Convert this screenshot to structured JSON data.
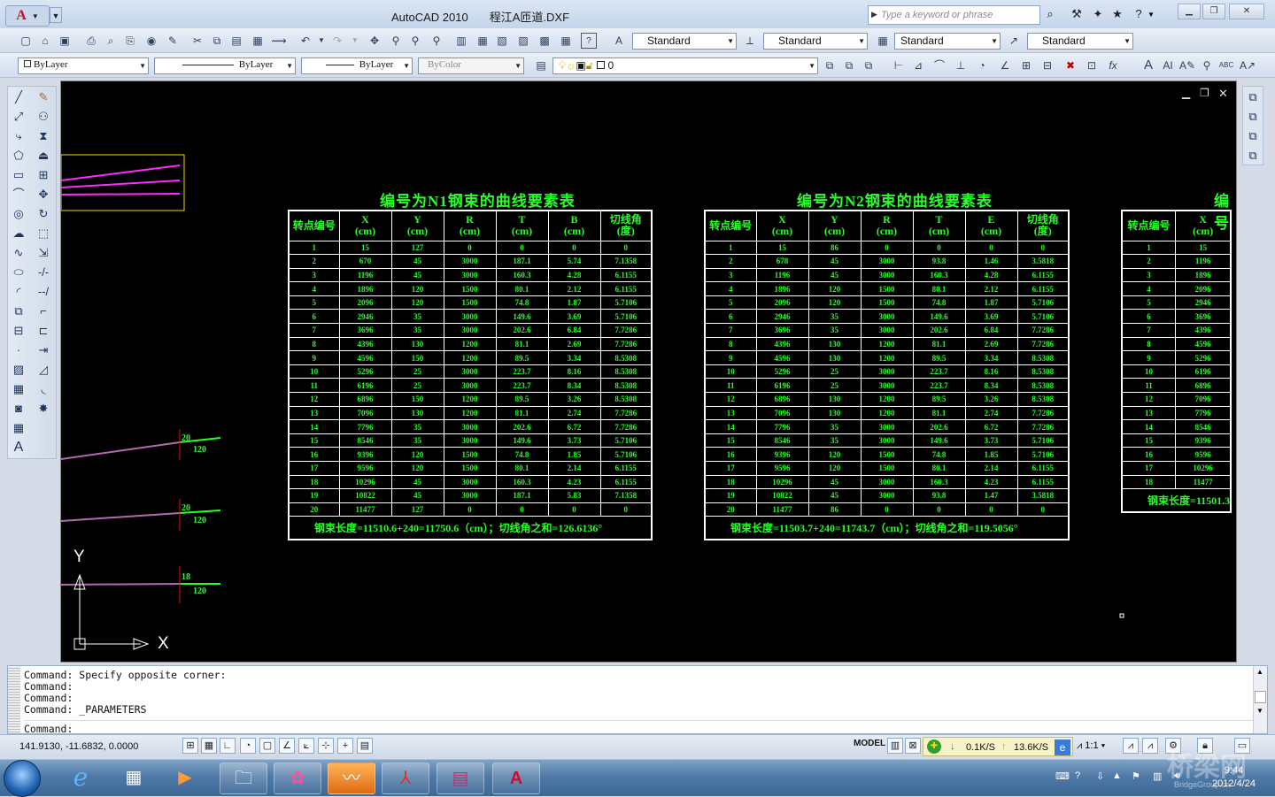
{
  "app": {
    "title": "AutoCAD 2010",
    "file_name": "程江A匝道.DXF"
  },
  "help": {
    "search_placeholder": "Type a keyword or phrase"
  },
  "icons": {
    "app_menu": "autocad-logo-icon",
    "window": [
      "minimize-icon",
      "restore-icon",
      "close-icon"
    ],
    "help_tools": [
      "binoculars-icon",
      "wrench-icon",
      "communication-icon",
      "favorites-icon",
      "help-icon"
    ]
  },
  "styles_toolbar": {
    "text_style": "Standard",
    "dim_style": "Standard",
    "table_style": "Standard",
    "mleader_style": "Standard"
  },
  "properties_toolbar": {
    "layer": "ByLayer",
    "linetype": "ByLayer",
    "lineweight": "ByLayer",
    "plotstyle": "ByColor",
    "current_layer": "0"
  },
  "drawing": {
    "tables": [
      {
        "title": "编号为N1钢束的曲线要素表",
        "headers": [
          [
            "转点编号",
            ""
          ],
          [
            "X",
            "(cm)"
          ],
          [
            "Y",
            "(cm)"
          ],
          [
            "R",
            "(cm)"
          ],
          [
            "T",
            "(cm)"
          ],
          [
            "B",
            "(cm)"
          ],
          [
            "切线角",
            "(度)"
          ]
        ],
        "rows": [
          [
            "1",
            "15",
            "127",
            "0",
            "0",
            "0",
            "0"
          ],
          [
            "2",
            "670",
            "45",
            "3000",
            "187.1",
            "5.74",
            "7.1358"
          ],
          [
            "3",
            "1196",
            "45",
            "3000",
            "160.3",
            "4.28",
            "6.1155"
          ],
          [
            "4",
            "1896",
            "120",
            "1500",
            "80.1",
            "2.12",
            "6.1155"
          ],
          [
            "5",
            "2096",
            "120",
            "1500",
            "74.8",
            "1.87",
            "5.7106"
          ],
          [
            "6",
            "2946",
            "35",
            "3000",
            "149.6",
            "3.69",
            "5.7106"
          ],
          [
            "7",
            "3696",
            "35",
            "3000",
            "202.6",
            "6.84",
            "7.7286"
          ],
          [
            "8",
            "4396",
            "130",
            "1200",
            "81.1",
            "2.69",
            "7.7286"
          ],
          [
            "9",
            "4596",
            "150",
            "1200",
            "89.5",
            "3.34",
            "8.5308"
          ],
          [
            "10",
            "5296",
            "25",
            "3000",
            "223.7",
            "8.16",
            "8.5308"
          ],
          [
            "11",
            "6196",
            "25",
            "3000",
            "223.7",
            "8.34",
            "8.5308"
          ],
          [
            "12",
            "6896",
            "150",
            "1200",
            "89.5",
            "3.26",
            "8.5308"
          ],
          [
            "13",
            "7096",
            "130",
            "1200",
            "81.1",
            "2.74",
            "7.7286"
          ],
          [
            "14",
            "7796",
            "35",
            "3000",
            "202.6",
            "6.72",
            "7.7286"
          ],
          [
            "15",
            "8546",
            "35",
            "3000",
            "149.6",
            "3.73",
            "5.7106"
          ],
          [
            "16",
            "9396",
            "120",
            "1500",
            "74.8",
            "1.85",
            "5.7106"
          ],
          [
            "17",
            "9596",
            "120",
            "1500",
            "80.1",
            "2.14",
            "6.1155"
          ],
          [
            "18",
            "10296",
            "45",
            "3000",
            "160.3",
            "4.23",
            "6.1155"
          ],
          [
            "19",
            "10822",
            "45",
            "3000",
            "187.1",
            "5.83",
            "7.1358"
          ],
          [
            "20",
            "11477",
            "127",
            "0",
            "0",
            "0",
            "0"
          ]
        ],
        "footer": "钢束长度=11510.6+240=11750.6（cm）；切线角之和=126.6136°"
      },
      {
        "title": "编号为N2钢束的曲线要素表",
        "headers": [
          [
            "转点编号",
            ""
          ],
          [
            "X",
            "(cm)"
          ],
          [
            "Y",
            "(cm)"
          ],
          [
            "R",
            "(cm)"
          ],
          [
            "T",
            "(cm)"
          ],
          [
            "E",
            "(cm)"
          ],
          [
            "切线角",
            "(度)"
          ]
        ],
        "rows": [
          [
            "1",
            "15",
            "86",
            "0",
            "0",
            "0",
            "0"
          ],
          [
            "2",
            "678",
            "45",
            "3000",
            "93.8",
            "1.46",
            "3.5818"
          ],
          [
            "3",
            "1196",
            "45",
            "3000",
            "160.3",
            "4.28",
            "6.1155"
          ],
          [
            "4",
            "1896",
            "120",
            "1500",
            "80.1",
            "2.12",
            "6.1155"
          ],
          [
            "5",
            "2096",
            "120",
            "1500",
            "74.8",
            "1.87",
            "5.7106"
          ],
          [
            "6",
            "2946",
            "35",
            "3000",
            "149.6",
            "3.69",
            "5.7106"
          ],
          [
            "7",
            "3696",
            "35",
            "3000",
            "202.6",
            "6.84",
            "7.7286"
          ],
          [
            "8",
            "4396",
            "130",
            "1200",
            "81.1",
            "2.69",
            "7.7286"
          ],
          [
            "9",
            "4596",
            "130",
            "1200",
            "89.5",
            "3.34",
            "8.5308"
          ],
          [
            "10",
            "5296",
            "25",
            "3000",
            "223.7",
            "8.16",
            "8.5308"
          ],
          [
            "11",
            "6196",
            "25",
            "3000",
            "223.7",
            "8.34",
            "8.5308"
          ],
          [
            "12",
            "6896",
            "130",
            "1200",
            "89.5",
            "3.26",
            "8.5308"
          ],
          [
            "13",
            "7096",
            "130",
            "1200",
            "81.1",
            "2.74",
            "7.7286"
          ],
          [
            "14",
            "7796",
            "35",
            "3000",
            "202.6",
            "6.72",
            "7.7286"
          ],
          [
            "15",
            "8546",
            "35",
            "3000",
            "149.6",
            "3.73",
            "5.7106"
          ],
          [
            "16",
            "9396",
            "120",
            "1500",
            "74.8",
            "1.85",
            "5.7106"
          ],
          [
            "17",
            "9596",
            "120",
            "1500",
            "80.1",
            "2.14",
            "6.1155"
          ],
          [
            "18",
            "10296",
            "45",
            "3000",
            "160.3",
            "4.23",
            "6.1155"
          ],
          [
            "19",
            "10822",
            "45",
            "3000",
            "93.8",
            "1.47",
            "3.5818"
          ],
          [
            "20",
            "11477",
            "86",
            "0",
            "0",
            "0",
            "0"
          ]
        ],
        "footer": "钢束长度=11503.7+240=11743.7（cm）；切线角之和=119.5056°"
      },
      {
        "title": "编号",
        "headers": [
          [
            "转点编号",
            ""
          ],
          [
            "X",
            "(cm)"
          ]
        ],
        "rows": [
          [
            "1",
            "15"
          ],
          [
            "2",
            "1196"
          ],
          [
            "3",
            "1896"
          ],
          [
            "4",
            "2096"
          ],
          [
            "5",
            "2946"
          ],
          [
            "6",
            "3696"
          ],
          [
            "7",
            "4396"
          ],
          [
            "8",
            "4596"
          ],
          [
            "9",
            "5296"
          ],
          [
            "10",
            "6196"
          ],
          [
            "11",
            "6896"
          ],
          [
            "12",
            "7096"
          ],
          [
            "13",
            "7796"
          ],
          [
            "14",
            "8546"
          ],
          [
            "15",
            "9396"
          ],
          [
            "16",
            "9596"
          ],
          [
            "17",
            "10296"
          ],
          [
            "18",
            "11477"
          ]
        ],
        "footer": "钢束长度=11501.3"
      }
    ],
    "annotations": [
      {
        "top": "20",
        "bottom": "120"
      },
      {
        "top": "20",
        "bottom": "120"
      },
      {
        "top": "18",
        "bottom": "120"
      }
    ],
    "ucs": {
      "x_label": "X",
      "y_label": "Y"
    }
  },
  "command_line": {
    "history": [
      "Command: Specify opposite corner:",
      "Command:",
      "Command:",
      "Command: _PARAMETERS"
    ],
    "prompt": "Command:"
  },
  "status": {
    "coordinates": "141.9130, -11.6832, 0.0000",
    "model": "MODEL",
    "download_speed": "0.1K/S",
    "upload_speed": "13.6K/S",
    "annotation_scale": "1:1"
  },
  "taskbar": {
    "apps": [
      "windows-start-icon",
      "internet-explorer-icon",
      "calculator-icon",
      "media-player-icon",
      "file-explorer-icon",
      "picasa-icon",
      "matlab-icon",
      "acrobat-icon",
      "winrar-icon",
      "autocad-icon"
    ],
    "time": "9:44",
    "date": "2012/4/24"
  },
  "watermark": {
    "text": "桥梁网",
    "sub": "BridgeGroup.cn"
  }
}
